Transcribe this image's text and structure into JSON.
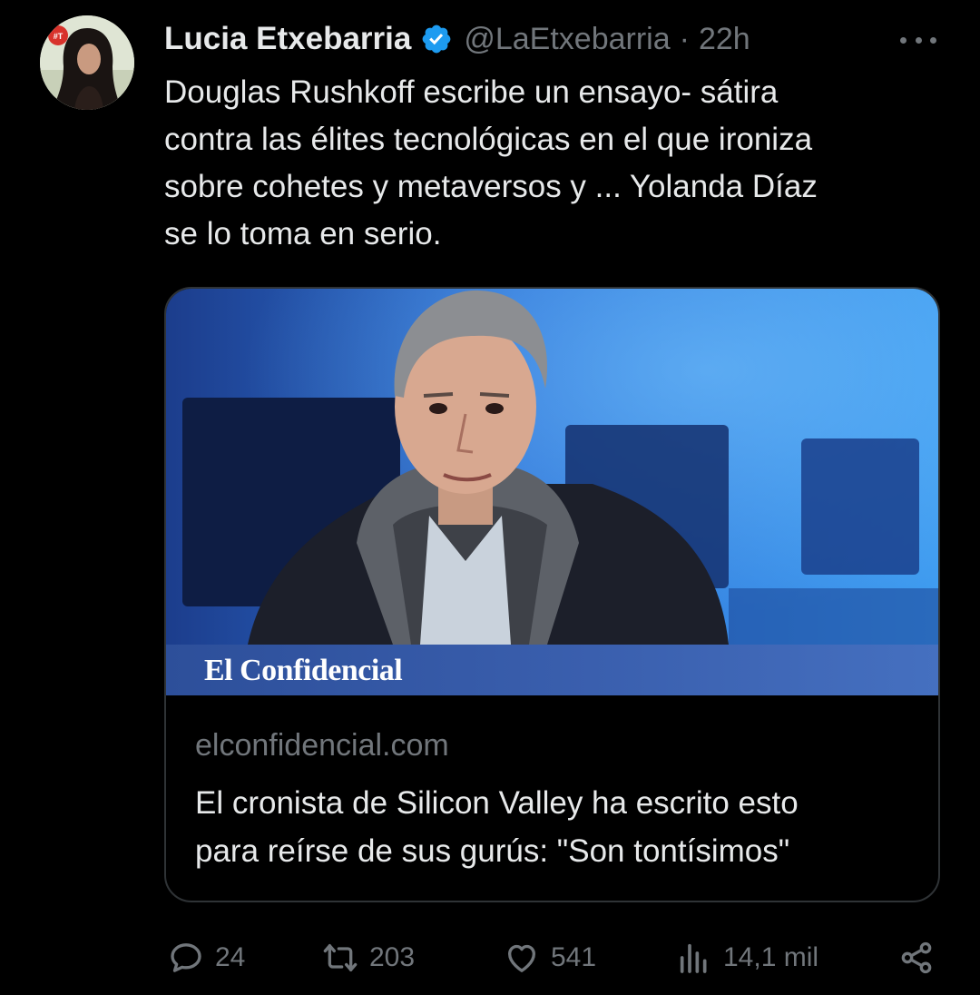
{
  "author": {
    "name": "Lucia Etxebarria",
    "handle": "@LaEtxebarria",
    "separator": "·",
    "time": "22h",
    "avatar_badge": "#T"
  },
  "tweet": {
    "lines": [
      "Douglas Rushkoff escribe un ensayo- sátira",
      "contra las élites tecnológicas en el que ironiza",
      "sobre cohetes y metaversos y ... Yolanda Díaz",
      "se lo toma en serio."
    ]
  },
  "card": {
    "brand": "El Confidencial",
    "domain": "elconfidencial.com",
    "title_lines": [
      "El cronista de Silicon Valley ha escrito esto",
      "para reírse de sus gurús: \"Son tontísimos\""
    ]
  },
  "actions": {
    "replies": "24",
    "retweets": "203",
    "likes": "541",
    "views": "14,1 mil"
  },
  "icons": {
    "verified": "verified-badge-icon",
    "more": "more-icon",
    "reply": "reply-icon",
    "retweet": "retweet-icon",
    "like": "heart-icon",
    "views": "views-icon",
    "share": "share-icon"
  },
  "colors": {
    "background": "#000000",
    "text": "#e7e9ea",
    "secondary": "#71767b",
    "verified": "#1d9bf0",
    "border": "#2f3336"
  }
}
